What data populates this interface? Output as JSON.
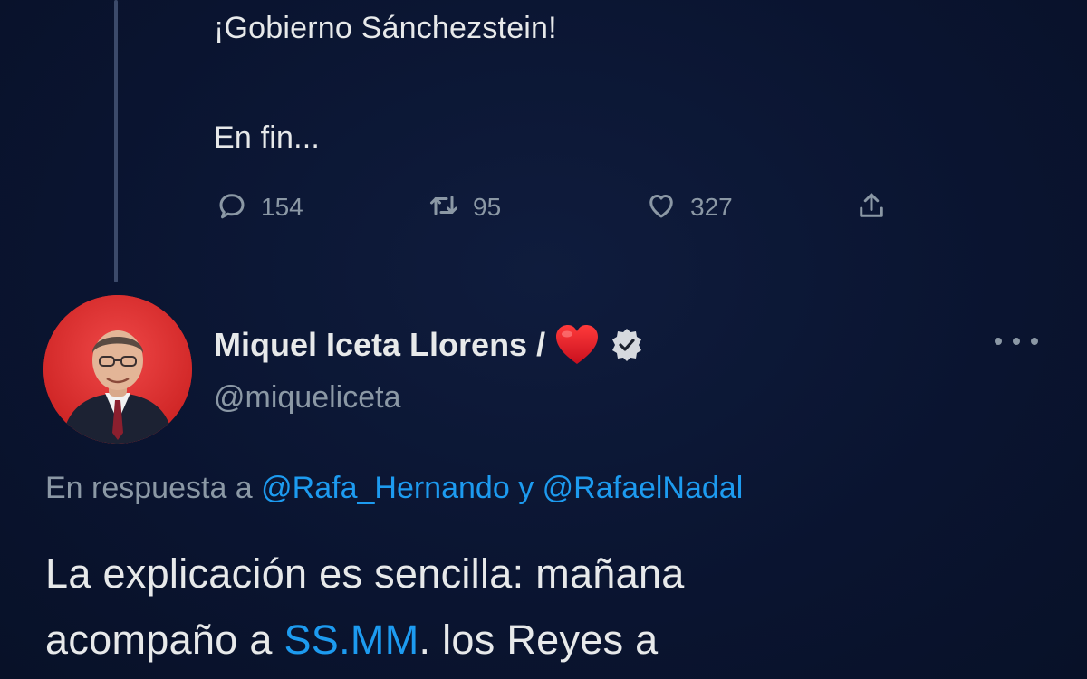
{
  "parent_tweet": {
    "line1": "¡Gobierno Sánchezstein!",
    "line2": "En fin...",
    "actions": {
      "reply_count": "154",
      "retweet_count": "95",
      "like_count": "327"
    }
  },
  "reply_tweet": {
    "author": {
      "display_name": "Miquel Iceta Llorens /",
      "handle": "@miqueliceta",
      "verified": true,
      "name_emoji": "red-heart"
    },
    "in_reply_to": {
      "prefix": "En respuesta a",
      "mention1": "@Rafa_Hernando",
      "connector": "y",
      "mention2": "@RafaelNadal"
    },
    "body": {
      "line1": "La explicación es sencilla: mañana",
      "line2_before": "acompaño a ",
      "line2_link": "SS.MM",
      "line2_after": ". los Reyes a"
    }
  },
  "colors": {
    "background": "#0b1530",
    "text": "#e7e9ea",
    "muted": "#8b98a5",
    "link": "#1d9bf0"
  },
  "icons": [
    "reply-icon",
    "retweet-icon",
    "like-icon",
    "share-icon",
    "verified-icon",
    "more-icon",
    "heart-emoji"
  ]
}
